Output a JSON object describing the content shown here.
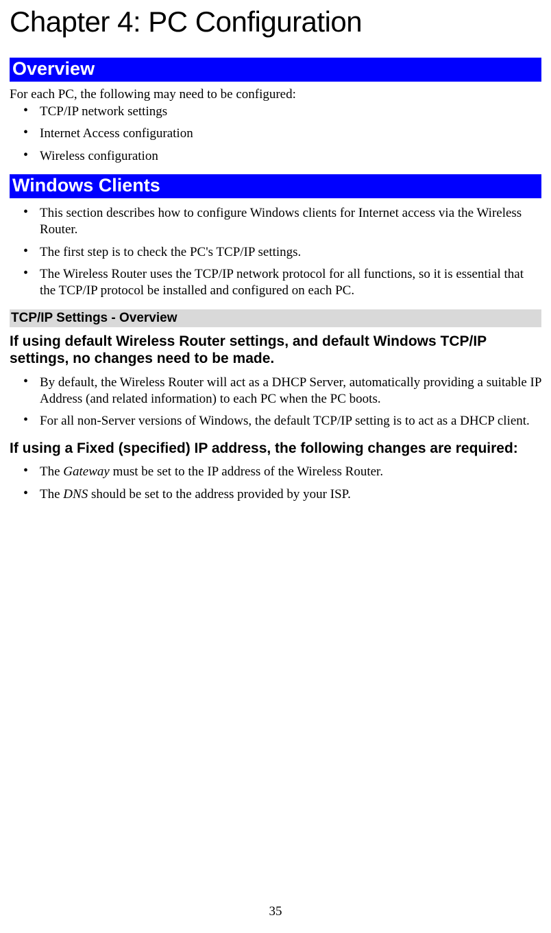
{
  "chapter_title": "Chapter 4: PC Configuration",
  "sections": {
    "overview": {
      "heading": "Overview",
      "lead": "For each PC, the following may need to be configured:",
      "items": [
        "TCP/IP network settings",
        "Internet Access configuration",
        "Wireless configuration"
      ]
    },
    "windows_clients": {
      "heading": "Windows Clients",
      "items": [
        "This section describes how to configure Windows clients for Internet access via the Wireless Router.",
        "The first step is to check the PC's TCP/IP settings.",
        "The Wireless Router uses the TCP/IP network protocol for all functions, so it is essential that the TCP/IP protocol be installed and configured on each PC."
      ],
      "subheading": "TCP/IP Settings - Overview",
      "strong1": "If using default Wireless Router settings, and default Windows TCP/IP settings, no changes need to be made.",
      "default_items": [
        "By default, the Wireless Router will act as a DHCP Server, automatically providing a suitable IP Address (and related information) to each PC when the PC boots.",
        "For all non-Server versions of Windows, the default TCP/IP setting is to act as a DHCP client."
      ],
      "strong2": "If using a Fixed (specified) IP address, the following changes are required:",
      "fixed_items_pre": [
        "The ",
        "The "
      ],
      "fixed_items_em": [
        "Gateway",
        "DNS"
      ],
      "fixed_items_post": [
        " must be set to the IP address of the Wireless Router.",
        " should be set to the address provided by your ISP."
      ]
    }
  },
  "page_number": "35"
}
